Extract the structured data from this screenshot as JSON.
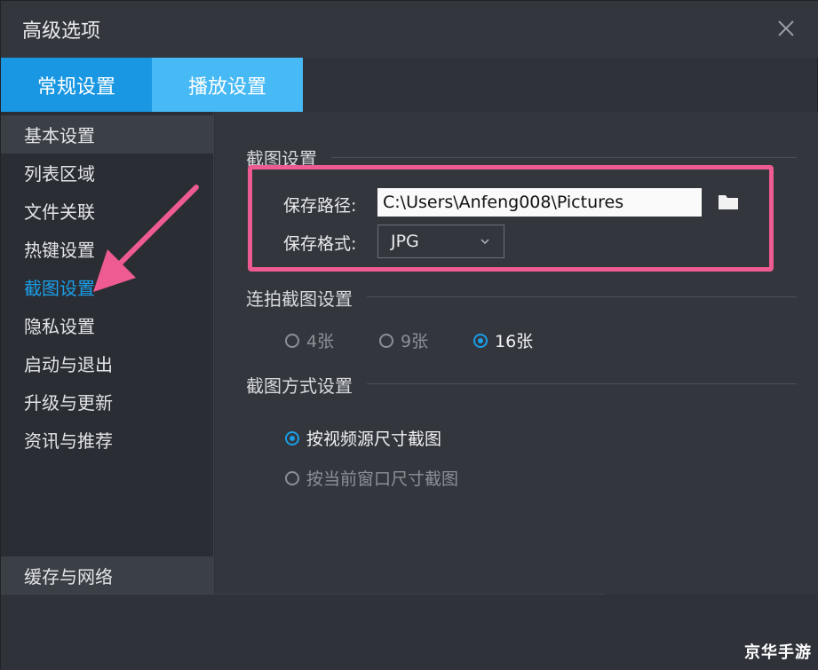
{
  "window": {
    "title": "高级选项"
  },
  "tabs": [
    {
      "label": "常规设置"
    },
    {
      "label": "播放设置"
    }
  ],
  "sidebar": {
    "items": [
      {
        "label": "基本设置"
      },
      {
        "label": "列表区域"
      },
      {
        "label": "文件关联"
      },
      {
        "label": "热键设置"
      },
      {
        "label": "截图设置"
      },
      {
        "label": "隐私设置"
      },
      {
        "label": "启动与退出"
      },
      {
        "label": "升级与更新"
      },
      {
        "label": "资讯与推荐"
      }
    ],
    "bottom_item": {
      "label": "缓存与网络"
    }
  },
  "screenshot_settings": {
    "title": "截图设置",
    "save_path_label": "保存路径:",
    "save_path_value": "C:\\Users\\Anfeng008\\Pictures",
    "save_format_label": "保存格式:",
    "save_format_value": "JPG"
  },
  "burst_settings": {
    "title": "连拍截图设置",
    "options": [
      {
        "label": "4张",
        "checked": false
      },
      {
        "label": "9张",
        "checked": false
      },
      {
        "label": "16张",
        "checked": true
      }
    ]
  },
  "method_settings": {
    "title": "截图方式设置",
    "options": [
      {
        "label": "按视频源尺寸截图",
        "checked": true
      },
      {
        "label": "按当前窗口尺寸截图",
        "checked": false
      }
    ]
  },
  "watermark": {
    "text": "京华手游"
  },
  "colors": {
    "accent": "#1997e3",
    "tab_secondary": "#47b9f5",
    "highlight": "#ee5a92"
  },
  "icons": {
    "close": "close-icon",
    "folder": "folder-icon",
    "dropdown": "chevron-down-icon"
  }
}
